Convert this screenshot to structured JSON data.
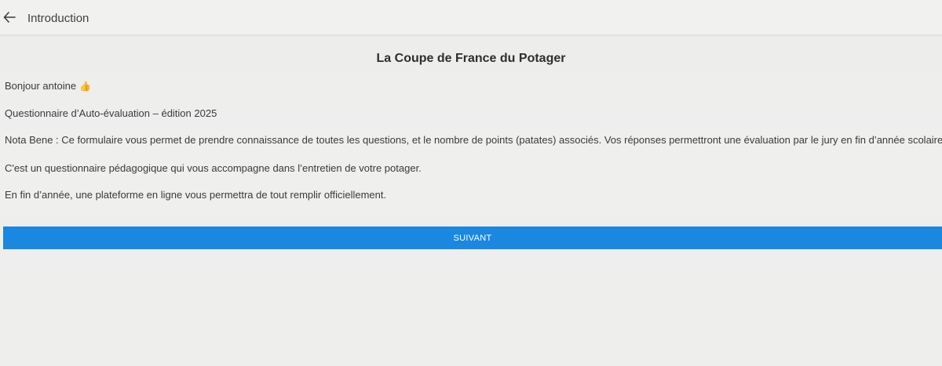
{
  "header": {
    "back_icon": "arrow-left-icon",
    "title": "Introduction"
  },
  "main": {
    "title": "La Coupe de France du Potager",
    "greeting": "Bonjour antoine",
    "greeting_emoji": "👍",
    "subtitle": "Questionnaire d’Auto-évaluation – édition 2025",
    "nota_bene": "Nota Bene : Ce formulaire vous permet de prendre connaissance de toutes les questions, et le nombre de points (patates) associés. Vos réponses permettront une évaluation par le jury en fin d’année scolaire.",
    "pedagogic": "C'est un questionnaire pédagogique qui vous accompagne dans l’entretien de votre potager.",
    "end_of_year": "En fin d’année, une plateforme en ligne vous permettra de tout remplir officiellement."
  },
  "actions": {
    "next_label": "SUIVANT"
  },
  "colors": {
    "accent": "#1a87e0",
    "background": "#eeeeed"
  }
}
